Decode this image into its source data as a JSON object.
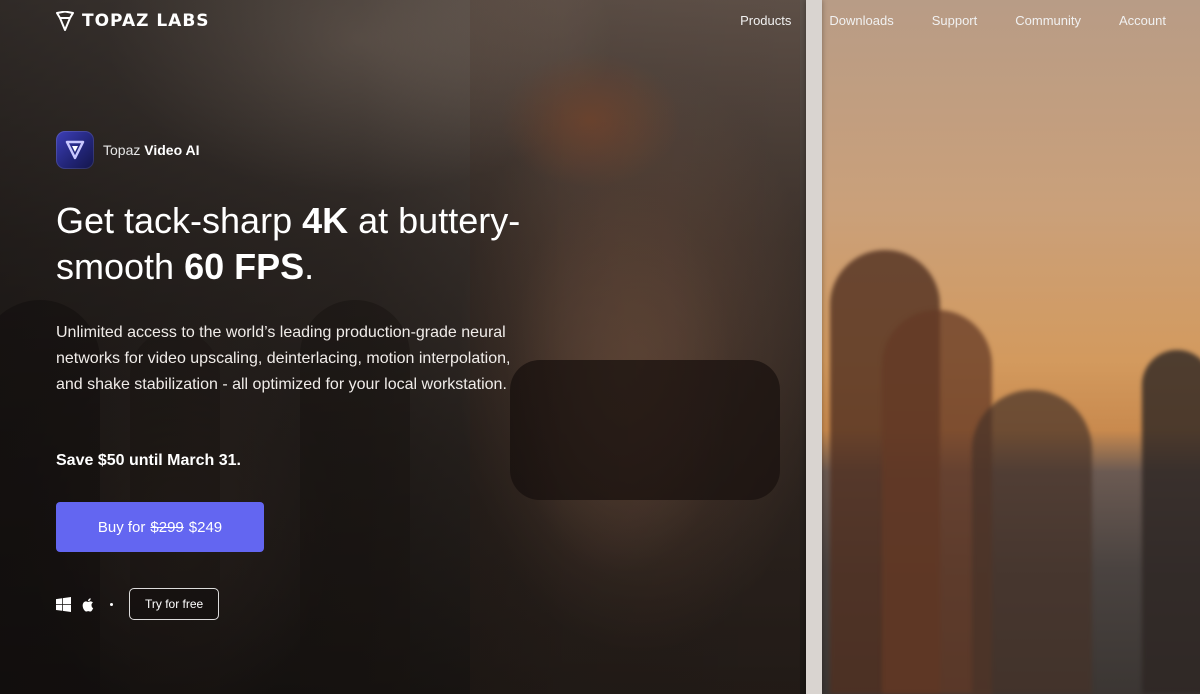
{
  "nav": {
    "brand": "TOPAZ LABS",
    "links": [
      "Products",
      "Downloads",
      "Support",
      "Community",
      "Account"
    ]
  },
  "hero": {
    "product_prefix": "Topaz",
    "product_name": "Video AI",
    "headline": {
      "part1": "Get tack-sharp ",
      "bold1": "4K",
      "part2": " at buttery-smooth ",
      "bold2": "60 FPS",
      "part3": "."
    },
    "description": "Unlimited access to the world’s leading production-grade neural networks for video upscaling, deinterlacing, motion interpolation, and shake stabilization - all optimized for your local workstation.",
    "promo": "Save $50 until March 31.",
    "buy": {
      "label": "Buy for",
      "old_price": "$299",
      "new_price": "$249"
    },
    "try_label": "Try for free",
    "platform_icons": [
      "windows-icon",
      "apple-icon"
    ]
  },
  "colors": {
    "accent": "#6366f1",
    "divider": "#d9d4d0"
  }
}
